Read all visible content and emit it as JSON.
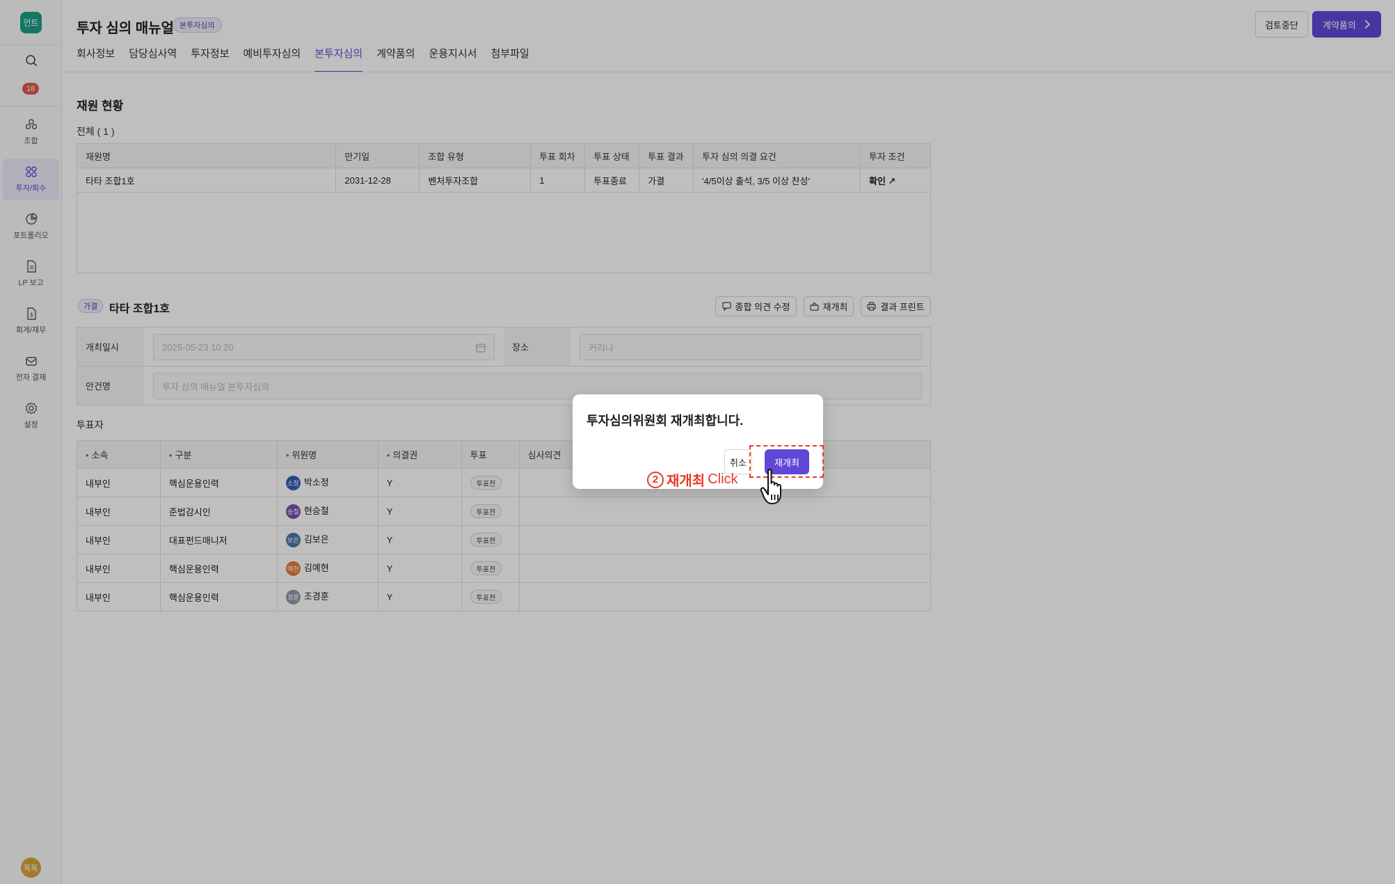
{
  "sidebar": {
    "logo": "언트",
    "badge_count": "18",
    "items": [
      {
        "label": "조합",
        "icon": "cooperative-icon"
      },
      {
        "label": "투자/회수",
        "icon": "investment-icon"
      },
      {
        "label": "포트폴리오",
        "icon": "pie-chart-icon"
      },
      {
        "label": "LP 보고",
        "icon": "report-icon"
      },
      {
        "label": "회계/재무",
        "icon": "accounting-icon"
      },
      {
        "label": "전자 결재",
        "icon": "mail-icon"
      },
      {
        "label": "설정",
        "icon": "gear-icon"
      }
    ],
    "user_avatar": "똑똑"
  },
  "header": {
    "title": "투자 심의 매뉴얼",
    "badge": "본투자심의",
    "stop_button": "검토중단",
    "next_button": "계약품의",
    "tabs": [
      "회사정보",
      "담당심사역",
      "투자정보",
      "예비투자심의",
      "본투자심의",
      "계약품의",
      "운용지시서",
      "첨부파일"
    ],
    "active_tab": "본투자심의"
  },
  "fund_status": {
    "title": "재원 현황",
    "total_label": "전체 ( 1 )",
    "columns": [
      "재원명",
      "만기일",
      "조합 유형",
      "투표 회차",
      "투표 상태",
      "투표 결과",
      "투자 심의 의결 요건",
      "투자 조건"
    ],
    "rows": [
      [
        "타타 조합1호",
        "2031-12-28",
        "벤처투자조합",
        "1",
        "투표종료",
        "가결",
        "'4/5이상 출석, 3/5 이상 찬성'",
        "확인 ↗"
      ]
    ]
  },
  "meeting": {
    "result_badge": "가결",
    "fund_name": "타타 조합1호",
    "actions": {
      "edit_opinion": "종합 의견 수정",
      "reopen": "재개최",
      "print": "결과 프린트"
    },
    "date_label": "개최일시",
    "date_value": "2025-05-23 10:20",
    "place_label": "장소",
    "place_value": "커리나",
    "agenda_label": "안건명",
    "agenda_value": "투자 심의 매뉴얼 본투자심의"
  },
  "voters": {
    "title": "투표자",
    "columns": [
      "소속",
      "구분",
      "위원명",
      "의결권",
      "투표",
      "심사의견"
    ],
    "rows": [
      {
        "org": "내부인",
        "role": "핵심운용인력",
        "avatar": "소정",
        "avatar_color": "#2f5fb0",
        "name": "박소정",
        "right": "Y",
        "vote": "투표전"
      },
      {
        "org": "내부인",
        "role": "준법감시인",
        "avatar": "승철",
        "avatar_color": "#7b4fb3",
        "name": "현승철",
        "right": "Y",
        "vote": "투표전"
      },
      {
        "org": "내부인",
        "role": "대표펀드매니저",
        "avatar": "보은",
        "avatar_color": "#4a78a8",
        "name": "김보은",
        "right": "Y",
        "vote": "투표전"
      },
      {
        "org": "내부인",
        "role": "핵심운용인력",
        "avatar": "예현",
        "avatar_color": "#e07b3a",
        "name": "김예현",
        "right": "Y",
        "vote": "투표전"
      },
      {
        "org": "내부인",
        "role": "핵심운용인력",
        "avatar": "경훈",
        "avatar_color": "#8e9aa8",
        "name": "조경훈",
        "right": "Y",
        "vote": "투표전"
      }
    ]
  },
  "modal": {
    "message": "투자심의위원회 재개최합니다.",
    "cancel": "취소",
    "confirm": "재개최"
  },
  "annotation": {
    "number": "2",
    "action": "재개최",
    "verb": "Click",
    "color": "#e8392a"
  }
}
